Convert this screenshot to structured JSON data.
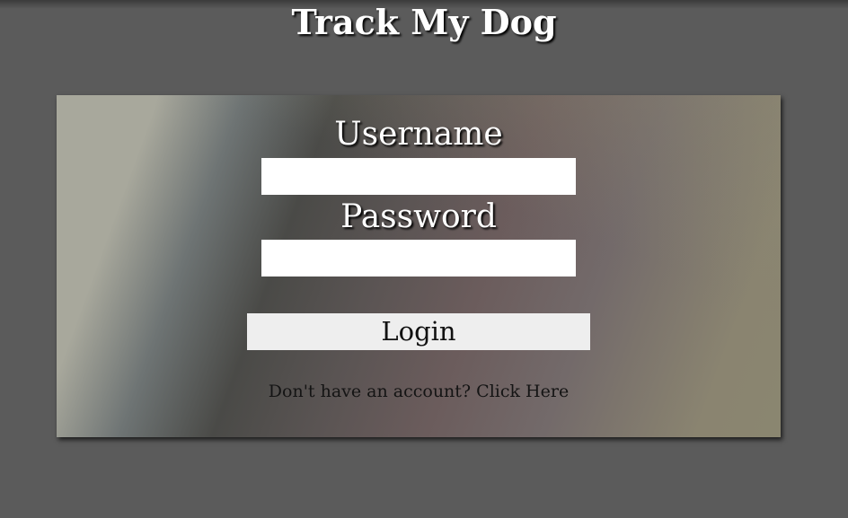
{
  "app": {
    "title": "Track My Dog"
  },
  "login_form": {
    "username_label": "Username",
    "username_value": "",
    "password_label": "Password",
    "password_value": "",
    "login_button_label": "Login",
    "signup_prompt": "Don't have an account?",
    "signup_link_label": "Click Here"
  },
  "colors": {
    "page_background": "#5b5b5b",
    "title_text": "#ffffff",
    "input_background": "#ffffff",
    "button_background": "#eeeeee"
  }
}
